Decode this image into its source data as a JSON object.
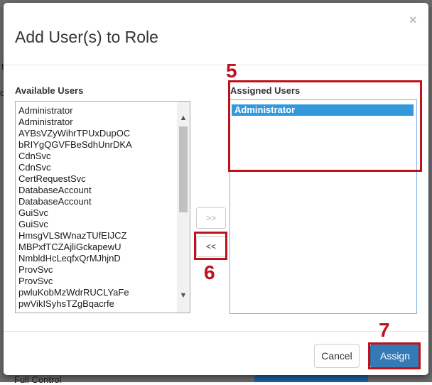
{
  "background": {
    "fragments": [
      "t",
      "c",
      "Full Control"
    ]
  },
  "modal": {
    "title": "Add User(s) to Role",
    "close_symbol": "×"
  },
  "available": {
    "label": "Available Users",
    "items": [
      "Administrator",
      "Administrator",
      "AYBsVZyWihrTPUxDupOC",
      "bRIYgQGVFBeSdhUnrDKA",
      "CdnSvc",
      "CdnSvc",
      "CertRequestSvc",
      "DatabaseAccount",
      "DatabaseAccount",
      "GuiSvc",
      "GuiSvc",
      "HmsgVLStWnazTUfEIJCZ",
      "MBPxfTCZAjliGckapewU",
      "NmbldHcLeqfxQrMJhjnD",
      "ProvSvc",
      "ProvSvc",
      "pwluKobMzWdrRUCLYaFe",
      "pwVikISyhsTZgBqacrfe"
    ]
  },
  "assigned": {
    "label": "Assigned Users",
    "items": [
      "Administrator"
    ],
    "selected_index": 0
  },
  "move_buttons": {
    "add_label": ">>",
    "remove_label": "<<"
  },
  "footer": {
    "cancel_label": "Cancel",
    "assign_label": "Assign"
  },
  "annotations": {
    "step_5": "5",
    "step_6": "6",
    "step_7": "7"
  },
  "colors": {
    "primary": "#337ab7",
    "annotation_red": "#c0111a",
    "selected_bg": "#3399dd"
  }
}
